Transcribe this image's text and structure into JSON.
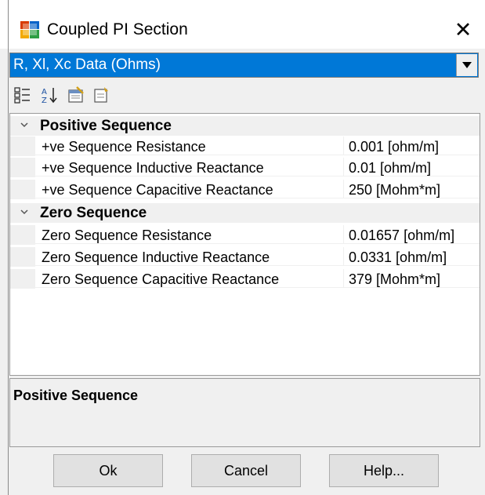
{
  "window": {
    "title": "Coupled PI Section",
    "close_glyph": "✕"
  },
  "combo": {
    "selected": "R, Xl, Xc Data (Ohms)"
  },
  "toolbar": {
    "icons": [
      "categorized-icon",
      "alphabetical-sort-icon",
      "property-pages-icon",
      "events-icon"
    ]
  },
  "grid": {
    "categories": [
      {
        "label": "Positive Sequence",
        "rows": [
          {
            "name": "+ve Sequence Resistance",
            "value": "0.001 [ohm/m]"
          },
          {
            "name": "+ve Sequence Inductive Reactance",
            "value": "0.01 [ohm/m]"
          },
          {
            "name": "+ve Sequence Capacitive Reactance",
            "value": "250 [Mohm*m]"
          }
        ]
      },
      {
        "label": "Zero Sequence",
        "rows": [
          {
            "name": "Zero Sequence Resistance",
            "value": "0.01657 [ohm/m]"
          },
          {
            "name": "Zero Sequence Inductive Reactance",
            "value": "0.0331 [ohm/m]"
          },
          {
            "name": "Zero Sequence Capacitive Reactance",
            "value": "379 [Mohm*m]"
          }
        ]
      }
    ]
  },
  "description": {
    "title": "Positive Sequence"
  },
  "buttons": {
    "ok": "Ok",
    "cancel": "Cancel",
    "help": "Help..."
  },
  "colors": {
    "selection": "#0078d7",
    "panel": "#f0f0f0"
  }
}
